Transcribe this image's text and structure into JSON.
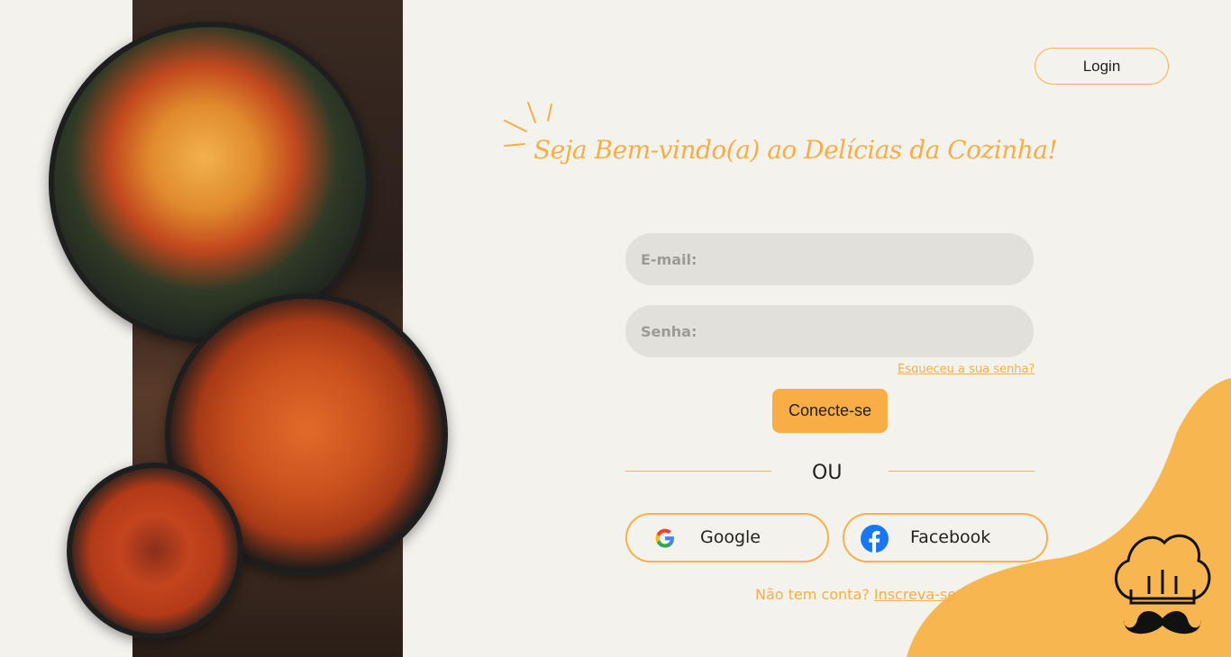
{
  "header": {
    "login_label": "Login"
  },
  "title": "Seja Bem-vindo(a) ao Delícias da Cozinha!",
  "form": {
    "email_placeholder": "E-mail:",
    "password_placeholder": "Senha:",
    "forgot_label": "Esqueceu a sua senha?",
    "submit_label": "Conecte-se"
  },
  "divider": "OU",
  "social": {
    "google_label": "Google",
    "facebook_label": "Facebook"
  },
  "signup": {
    "prompt": "Não tem conta?",
    "link": "Inscreva-se"
  },
  "colors": {
    "accent": "#f8ad45",
    "background": "#f4f2ed",
    "field": "#e2e0db"
  }
}
